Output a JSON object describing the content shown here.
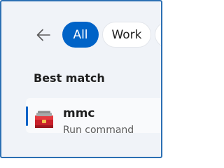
{
  "filters": {
    "back_icon": "back-arrow-icon",
    "tabs": [
      {
        "label": "All",
        "selected": true
      },
      {
        "label": "Work",
        "selected": false
      }
    ]
  },
  "section": {
    "heading": "Best match"
  },
  "result": {
    "title": "mmc",
    "subtitle": "Run command",
    "icon": "toolbox-icon"
  },
  "colors": {
    "accent": "#0063c7",
    "window_border": "#2b6fb3",
    "background": "#f0f3f8"
  }
}
